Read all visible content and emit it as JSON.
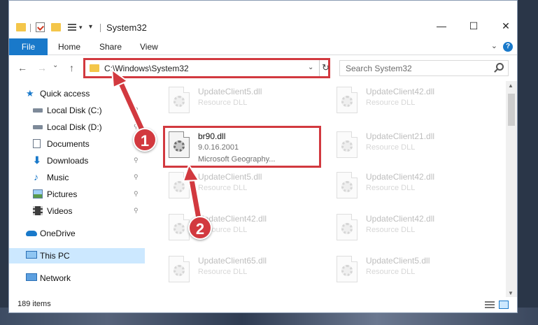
{
  "window": {
    "title": "System32",
    "controls": {
      "minimize": "—",
      "maximize": "☐",
      "close": "✕"
    }
  },
  "quick_access_toolbar": {
    "icons": [
      "folder-icon",
      "properties-icon",
      "new-folder-icon",
      "view-menu-icon",
      "customize-icon"
    ]
  },
  "ribbon": {
    "file_tab": "File",
    "tabs": [
      "Home",
      "Share",
      "View"
    ],
    "help": "?",
    "accent_color": "#1979ca"
  },
  "nav": {
    "back": "←",
    "forward": "→",
    "recent": "⌄",
    "up": "↑",
    "address": "C:\\Windows\\System32",
    "address_dropdown": "⌄",
    "refresh": "↻",
    "search_placeholder": "Search System32"
  },
  "sidebar": {
    "items": [
      {
        "label": "Quick access",
        "icon": "star-icon",
        "pinned": false
      },
      {
        "label": "Local Disk (C:)",
        "icon": "drive-icon",
        "pinned": true
      },
      {
        "label": "Local Disk (D:)",
        "icon": "drive-icon",
        "pinned": true
      },
      {
        "label": "Documents",
        "icon": "documents-icon",
        "pinned": true
      },
      {
        "label": "Downloads",
        "icon": "downloads-icon",
        "pinned": true
      },
      {
        "label": "Music",
        "icon": "music-icon",
        "pinned": true
      },
      {
        "label": "Pictures",
        "icon": "pictures-icon",
        "pinned": true
      },
      {
        "label": "Videos",
        "icon": "videos-icon",
        "pinned": true
      },
      {
        "label": "OneDrive",
        "icon": "cloud-icon",
        "pinned": false
      },
      {
        "label": "This PC",
        "icon": "computer-icon",
        "pinned": false,
        "selected": true
      },
      {
        "label": "Network",
        "icon": "network-icon",
        "pinned": false
      }
    ],
    "pin_glyph": "📌"
  },
  "files": [
    {
      "name": "UpdateClient5.dll",
      "type": "Resource DLL",
      "faded": true
    },
    {
      "name": "UpdateClient42.dll",
      "type": "Resource DLL",
      "faded": true
    },
    {
      "name": "br90.dll",
      "version": "9.0.16.2001",
      "company": "Microsoft Geography...",
      "faded": false,
      "highlighted": true
    },
    {
      "name": "UpdateClient21.dll",
      "type": "Resource DLL",
      "faded": true
    },
    {
      "name": "UpdateClient5.dll",
      "type": "Resource DLL",
      "faded": true
    },
    {
      "name": "UpdateClient42.dll",
      "type": "Resource DLL",
      "faded": true
    },
    {
      "name": "UpdateClient42.dll",
      "type": "Resource DLL",
      "faded": true
    },
    {
      "name": "UpdateClient42.dll",
      "type": "Resource DLL",
      "faded": true
    },
    {
      "name": "UpdateClient65.dll",
      "type": "Resource DLL",
      "faded": true
    },
    {
      "name": "UpdateClient5.dll",
      "type": "Resource DLL",
      "faded": true
    }
  ],
  "status": {
    "item_count": "189 items"
  },
  "annotations": {
    "step1": "1",
    "step2": "2",
    "color": "#d2393f"
  }
}
